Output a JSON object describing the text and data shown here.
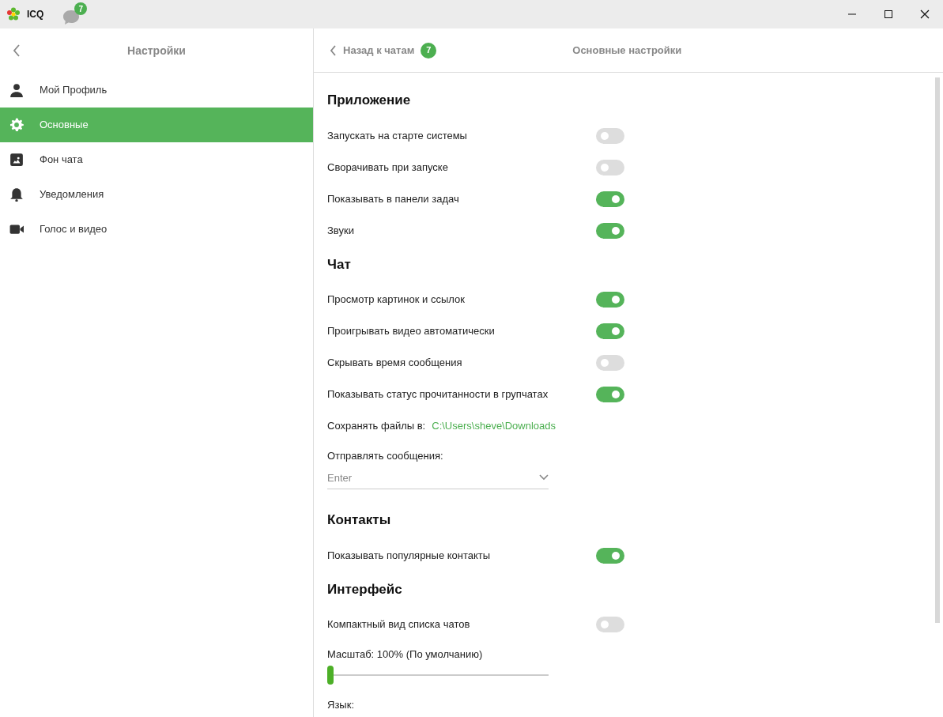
{
  "window": {
    "title": "ICQ",
    "chat_badge": "7"
  },
  "sidebar": {
    "title": "Настройки",
    "items": [
      {
        "label": "Мой Профиль",
        "kind": "person",
        "selected": false
      },
      {
        "label": "Основные",
        "kind": "gear",
        "selected": true
      },
      {
        "label": "Фон чата",
        "kind": "picture",
        "selected": false
      },
      {
        "label": "Уведомления",
        "kind": "bell",
        "selected": false
      },
      {
        "label": "Голос и видео",
        "kind": "camera",
        "selected": false
      }
    ]
  },
  "header": {
    "back_label": "Назад к чатам",
    "back_badge": "7",
    "title": "Основные настройки"
  },
  "sections": [
    {
      "title": "Приложение",
      "items": [
        {
          "kind": "toggle",
          "label": "Запускать на старте системы",
          "on": false
        },
        {
          "kind": "toggle",
          "label": "Сворачивать при запуске",
          "on": false
        },
        {
          "kind": "toggle",
          "label": "Показывать в панели задач",
          "on": true
        },
        {
          "kind": "toggle",
          "label": "Звуки",
          "on": true
        }
      ]
    },
    {
      "title": "Чат",
      "items": [
        {
          "kind": "toggle",
          "label": "Просмотр картинок и ссылок",
          "on": true
        },
        {
          "kind": "toggle",
          "label": "Проигрывать видео автоматически",
          "on": true
        },
        {
          "kind": "toggle",
          "label": "Скрывать время сообщения",
          "on": false
        },
        {
          "kind": "toggle",
          "label": "Показывать статус прочитанности в групчатах",
          "on": true
        },
        {
          "kind": "path",
          "label": "Сохранять файлы в:",
          "value": "C:\\Users\\sheve\\Downloads"
        },
        {
          "kind": "dropdown",
          "label": "Отправлять сообщения:",
          "value": "Enter"
        }
      ]
    },
    {
      "title": "Контакты",
      "items": [
        {
          "kind": "toggle",
          "label": "Показывать популярные контакты",
          "on": true
        }
      ]
    },
    {
      "title": "Интерфейс",
      "items": [
        {
          "kind": "toggle",
          "label": "Компактный вид списка чатов",
          "on": false
        },
        {
          "kind": "slider",
          "label": "Масштаб: 100% (По умолчанию)",
          "level": 0
        },
        {
          "kind": "label",
          "label": "Язык:"
        }
      ]
    }
  ]
}
